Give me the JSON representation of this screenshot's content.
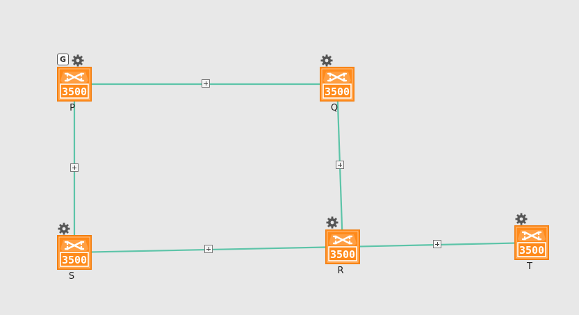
{
  "colors": {
    "background": "#e8e8e8",
    "link": "#5cc4a8",
    "node_fill": "#ff8a1a",
    "node_border": "#f07d10",
    "gear": "#555555"
  },
  "icons": {
    "node": "switch-3500-icon",
    "settings": "gear-icon",
    "group": "group-badge-icon",
    "expand": "expand-plus-icon"
  },
  "device_model_text": "3500",
  "group_badge_text": "G",
  "nodes": [
    {
      "id": "P",
      "label": "P",
      "has_gear": true,
      "has_group_badge": true
    },
    {
      "id": "Q",
      "label": "Q",
      "has_gear": true,
      "has_group_badge": false
    },
    {
      "id": "R",
      "label": "R",
      "has_gear": true,
      "has_group_badge": false
    },
    {
      "id": "S",
      "label": "S",
      "has_gear": true,
      "has_group_badge": false
    },
    {
      "id": "T",
      "label": "T",
      "has_gear": true,
      "has_group_badge": false
    }
  ],
  "links": [
    {
      "from": "P",
      "to": "Q"
    },
    {
      "from": "Q",
      "to": "R"
    },
    {
      "from": "P",
      "to": "S"
    },
    {
      "from": "S",
      "to": "R"
    },
    {
      "from": "R",
      "to": "T"
    }
  ]
}
